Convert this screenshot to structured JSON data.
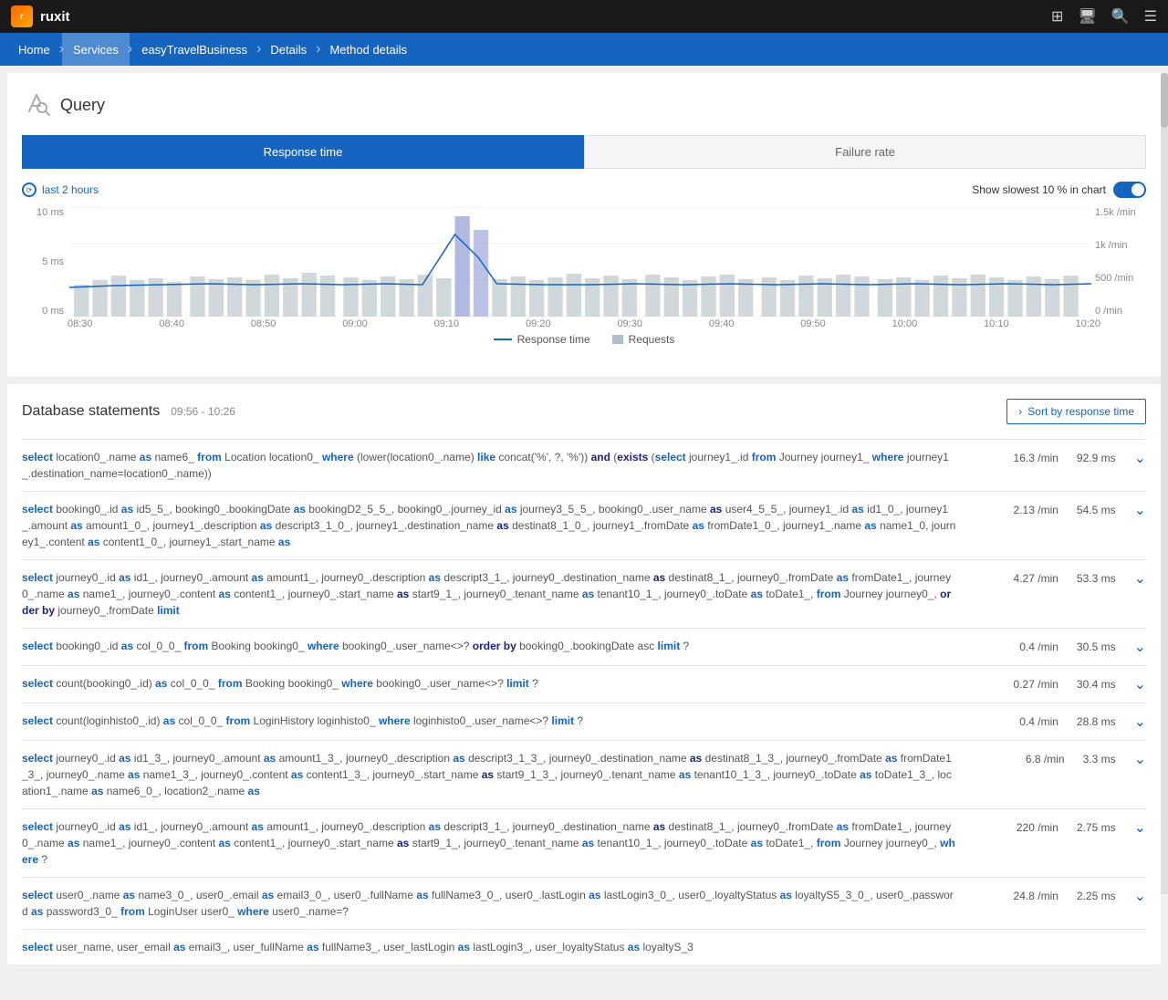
{
  "topbar": {
    "logo_text": "ruxit",
    "icons": [
      "windows-icon",
      "monitor-icon",
      "search-icon",
      "menu-icon"
    ]
  },
  "breadcrumb": {
    "items": [
      "Home",
      "Services",
      "easyTravelBusiness",
      "Details",
      "Method details"
    ]
  },
  "query": {
    "title": "Query",
    "tabs": {
      "response_time": "Response time",
      "failure_rate": "Failure rate"
    },
    "time_label": "last 2 hours",
    "show_slowest_label": "Show slowest 10 % in chart",
    "chart": {
      "y_labels_left": [
        "10 ms",
        "5 ms",
        "0 ms"
      ],
      "y_labels_right": [
        "1.5k /min",
        "1k /min",
        "500 /min",
        "0 /min"
      ],
      "x_labels": [
        "08:30",
        "08:40",
        "08:50",
        "09:00",
        "09:10",
        "09:20",
        "09:30",
        "09:40",
        "09:50",
        "10:00",
        "10:10",
        "10:20"
      ],
      "legend_response_time": "Response time",
      "legend_requests": "Requests"
    }
  },
  "db_statements": {
    "title": "Database statements",
    "timerange": "09:56 - 10:26",
    "sort_btn": "Sort by response time",
    "rows": [
      {
        "text": "select location0_.name as name6_ from Location location0_ where (lower(location0_.name) like concat('%', ?, '%')) and (exists (select journey1_.id from Journey journey1_ where journey1_.destination_name=location0_.name))",
        "rate": "16.3 /min",
        "time": "92.9 ms"
      },
      {
        "text": "select booking0_.id as id5_5_, booking0_.bookingDate as bookingD2_5_5_, booking0_.journey_id as journey3_5_5_, booking0_.user_name as user4_5_5_, journey1_.id as id1_0_, journey1_.amount as amount1_0_, journey1_.description as descript3_1_0_, journey1_.destination_name as destinat8_1_0_, journey1_.fromDate as fromDate1_0_, journey1_.name as name1_0, journey1_. content as content1_0_, journey1_.start_name as",
        "rate": "2.13 /min",
        "time": "54.5 ms"
      },
      {
        "text": "select journey0_.id as id1_, journey0_.amount as amount1_, journey0_.description as descript3_1_, journey0_.destination_name as destinat8_1_, journey0_.fromDate as fromDate1_, journey0_.name as name1_, journey0_.content as content1_, journey0_.start_name as start9_1_, journey0_.tenant_name as tenant10_1_, journey0_.toDate as toDate1_, from Journey journey0_, order by journey0_.fromDate limit",
        "rate": "4.27 /min",
        "time": "53.3 ms"
      },
      {
        "text": "select booking0_.id as col_0_0_ from Booking booking0_ where booking0_.user_name<>? order by booking0_.bookingDate asc limit ?",
        "rate": "0.4 /min",
        "time": "30.5 ms"
      },
      {
        "text": "select count(booking0_.id) as col_0_0_ from Booking booking0_ where booking0_.user_name<>? limit ?",
        "rate": "0.27 /min",
        "time": "30.4 ms"
      },
      {
        "text": "select count(loginhisto0_.id) as col_0_0_ from LoginHistory loginhisto0_ where loginhisto0_.user_name<>? limit ?",
        "rate": "0.4 /min",
        "time": "28.8 ms"
      },
      {
        "text": "select journey0_.id as id1_3_, journey0_.amount as amount1_3_, journey0_.description as descript3_1_3_, journey0_.destination_name as destinat8_1_3_, journey0_.fromDate as fromDate1_3_, journey0_.name as name1_3_, journey0_.content as content1_3_, journey0_.start_name as start9_1_3_, journey0_.tenant_name as tenant10_1_3_, journey0_.toDate as toDate1_3_, location1_.name as name6_0_, location2_.name as",
        "rate": "6.8 /min",
        "time": "3.3 ms"
      },
      {
        "text": "select journey0_.id as id1_, journey0_.amount as amount1_, journey0_.description as descript3_1_, journey0_.destination_name as destinat8_1_, journey0_.fromDate as fromDate1_, journey0_.name as name1_, journey0_.content as content1_, journey0_.start_name as start9_1_, journey0_.tenant_name as tenant10_1_, journey0_.toDate as toDate1_, from Journey journey0_, where ?",
        "rate": "220 /min",
        "time": "2.75 ms"
      },
      {
        "text": "select user0_.name as name3_0_, user0_.email as email3_0_, user0_.fullName as fullName3_0_, user0_.lastLogin as lastLogin3_0_, user0_.loyaltyStatus as loyaltyS5_3_0_, user0_.password as password3_0_ from LoginUser user0_ where user0_.name=?",
        "rate": "24.8 /min",
        "time": "2.25 ms"
      },
      {
        "text": "select user_name, user_email as email3_, user_fullName as fullName3_, user_lastLogin as lastLogin3_, user_loyaltyStatus as loyaltyS_3",
        "rate": "",
        "time": ""
      }
    ]
  },
  "keywords": {
    "select": "select",
    "from": "from",
    "where": "where",
    "as": "as",
    "and": "and",
    "exists": "exists",
    "order_by": "order by",
    "limit": "limit",
    "like": "like",
    "concat": "concat"
  }
}
